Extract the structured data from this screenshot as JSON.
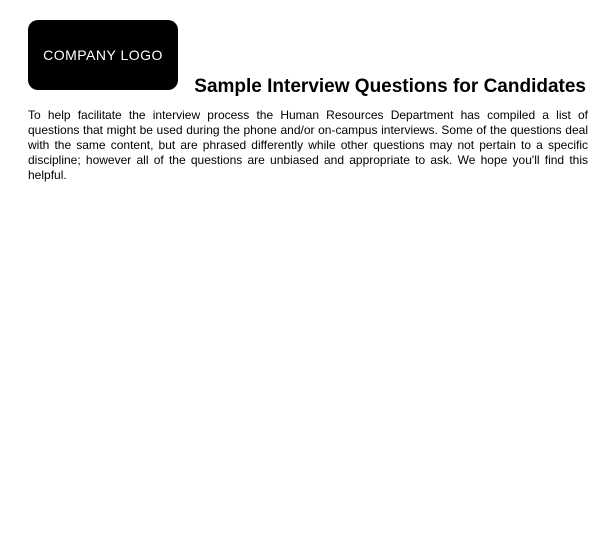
{
  "logo": {
    "text": "COMPANY LOGO"
  },
  "title": "Sample Interview Questions for Candidates",
  "intro": "To help facilitate the interview process the Human Resources Department has compiled a list of questions that might be used during the phone and/or on-campus interviews. Some of the questions deal with the same content, but are phrased differently while other questions may not pertain to a specific discipline; however all of the questions are unbiased and appropriate to ask. We hope you'll find this helpful."
}
